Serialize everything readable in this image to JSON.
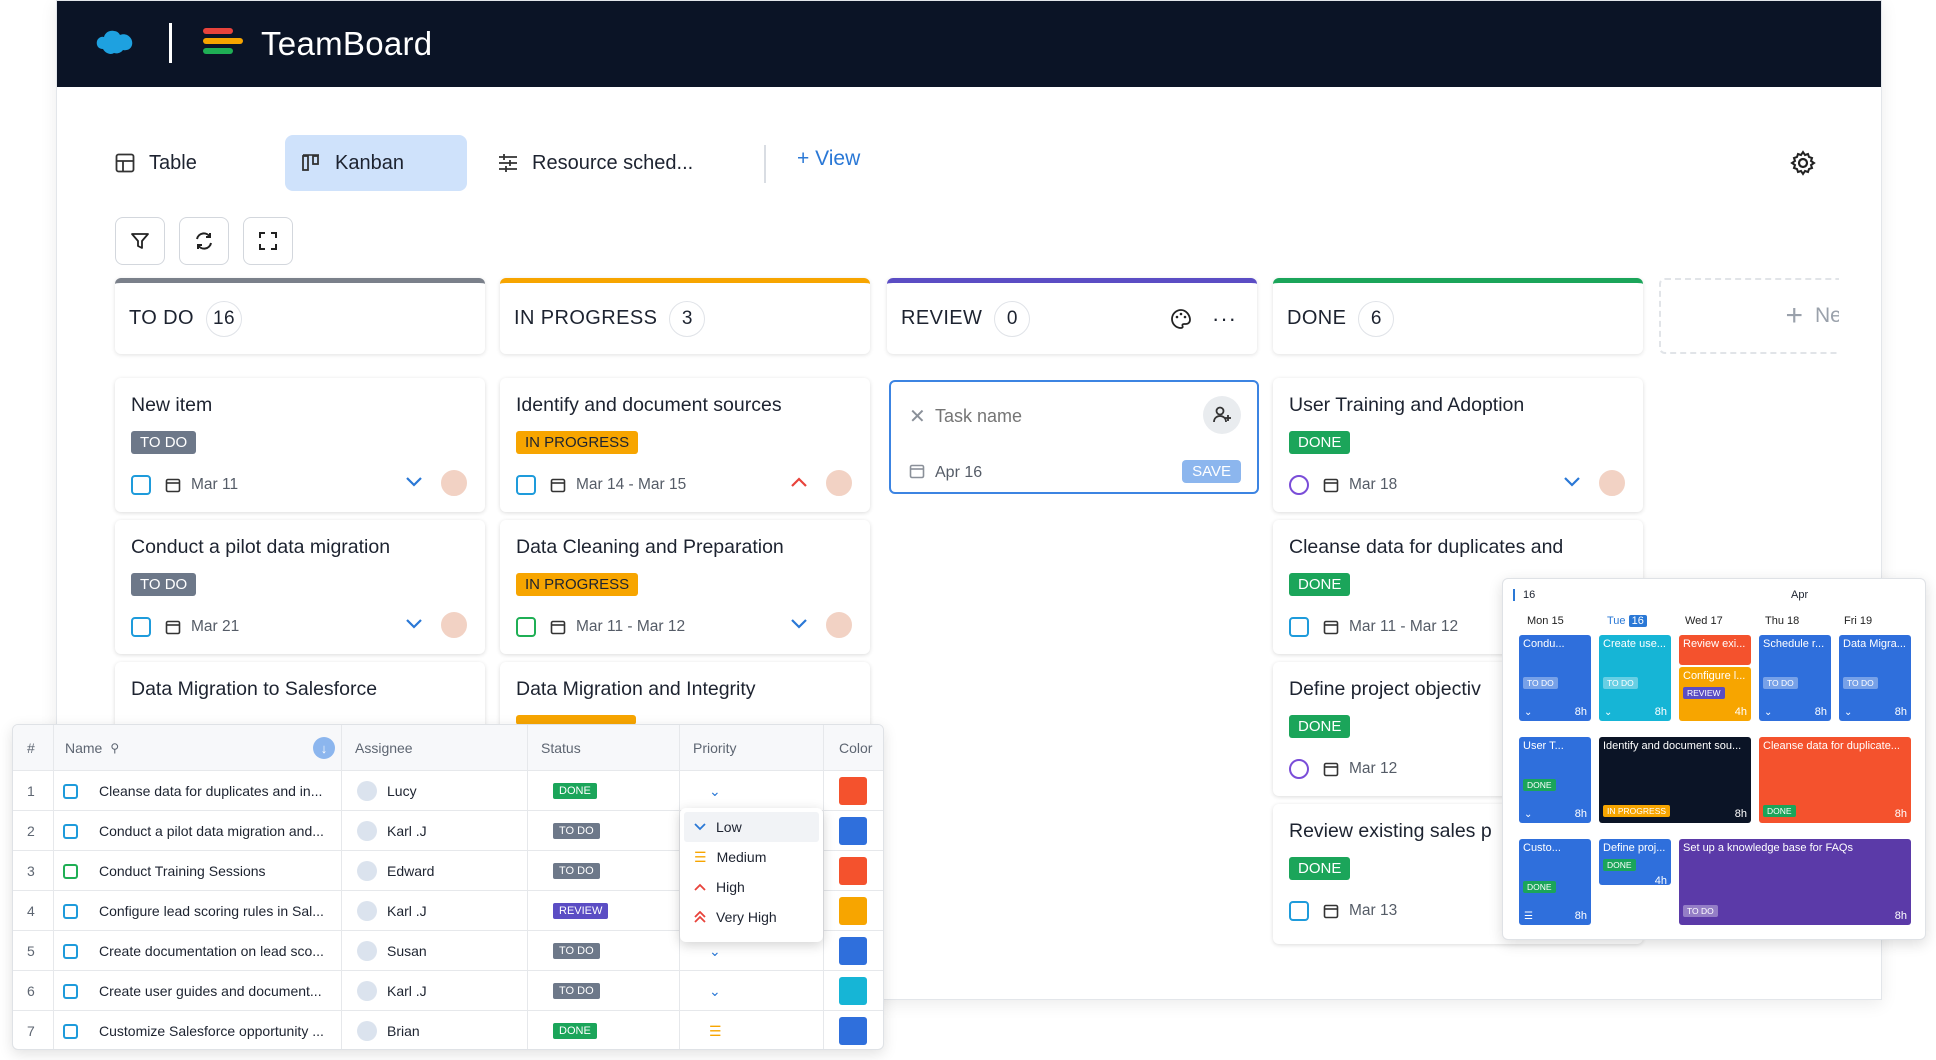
{
  "app": {
    "brand": "TeamBoard",
    "colors": {
      "topbar": "#0b1426",
      "accent": "#2a78d6"
    }
  },
  "views": {
    "tabs": [
      {
        "label": "Table",
        "icon": "table-icon"
      },
      {
        "label": "Kanban",
        "icon": "kanban-icon",
        "active": true
      },
      {
        "label": "Resource sched...",
        "icon": "resource-icon"
      }
    ],
    "add_view": "View"
  },
  "columns": [
    {
      "title": "TO DO",
      "count": "16",
      "color": "#7a808a",
      "cards": [
        {
          "title": "New item",
          "status": "TO DO",
          "date": "Mar 11"
        },
        {
          "title": "Conduct a pilot data migration",
          "status": "TO DO",
          "date": "Mar 21"
        },
        {
          "title": "Data Migration to Salesforce"
        }
      ]
    },
    {
      "title": "IN PROGRESS",
      "count": "3",
      "color": "#f7a500",
      "cards": [
        {
          "title": "Identify and document sources",
          "status": "IN PROGRESS",
          "date": "Mar 14 - Mar 15"
        },
        {
          "title": "Data Cleaning and Preparation",
          "status": "IN PROGRESS",
          "date": "Mar 11 - Mar 12"
        },
        {
          "title": "Data Migration and Integrity"
        }
      ]
    },
    {
      "title": "REVIEW",
      "count": "0",
      "color": "#5b4dc4",
      "new_task": {
        "placeholder": "Task name",
        "date": "Apr 16",
        "save": "SAVE"
      }
    },
    {
      "title": "DONE",
      "count": "6",
      "color": "#1ba55a",
      "cards": [
        {
          "title": "User Training and Adoption",
          "status": "DONE",
          "date": "Mar 18"
        },
        {
          "title": "Cleanse data for duplicates and",
          "status": "DONE",
          "date": "Mar 11 - Mar 12"
        },
        {
          "title": "Define project objectiv",
          "status": "DONE",
          "date": "Mar 12"
        },
        {
          "title": "Review existing sales p",
          "status": "DONE",
          "date": "Mar 13"
        }
      ]
    }
  ],
  "new_column": "New",
  "table": {
    "headers": {
      "num": "#",
      "name": "Name",
      "assignee": "Assignee",
      "status": "Status",
      "priority": "Priority",
      "color": "Color"
    },
    "rows": [
      {
        "n": "1",
        "name": "Cleanse data for duplicates and in...",
        "assignee": "Lucy",
        "status": "DONE",
        "color": "#f4522d"
      },
      {
        "n": "2",
        "name": "Conduct a pilot data migration and...",
        "assignee": "Karl .J",
        "status": "TO DO",
        "color": "#2f6fdc"
      },
      {
        "n": "3",
        "name": "Conduct Training Sessions",
        "assignee": "Edward",
        "status": "TO DO",
        "color": "#f4522d"
      },
      {
        "n": "4",
        "name": "Configure lead scoring rules in Sal...",
        "assignee": "Karl .J",
        "status": "REVIEW",
        "color": "#f7a500"
      },
      {
        "n": "5",
        "name": "Create documentation on lead sco...",
        "assignee": "Susan",
        "status": "TO DO",
        "color": "#2f6fdc"
      },
      {
        "n": "6",
        "name": "Create user guides and document...",
        "assignee": "Karl .J",
        "status": "TO DO",
        "color": "#16b5d6"
      },
      {
        "n": "7",
        "name": "Customize Salesforce opportunity ...",
        "assignee": "Brian",
        "status": "DONE",
        "color": "#2f6fdc"
      }
    ]
  },
  "priority_options": [
    "Low",
    "Medium",
    "High",
    "Very High"
  ],
  "calendar": {
    "week": "16",
    "month": "Apr",
    "days": [
      "Mon 15",
      "Tue",
      "Wed 17",
      "Thu 18",
      "Fri 19"
    ],
    "today": "16",
    "events": {
      "e1": "Condu...",
      "e2": "Create use...",
      "e3": "Review exi...",
      "e4": "Configure l...",
      "e5": "Schedule r...",
      "e6": "Data Migra...",
      "e7": "User T...",
      "e8": "Identify and document sou...",
      "e9": "Cleanse data for duplicate...",
      "e10": "Custo...",
      "e11": "Define proj...",
      "e12": "Set up a knowledge base for FAQs"
    },
    "labels": {
      "todo": "TO DO",
      "review": "REVIEW",
      "done": "DONE",
      "prog": "IN PROGRESS",
      "h8": "8h",
      "h4": "4h"
    }
  }
}
